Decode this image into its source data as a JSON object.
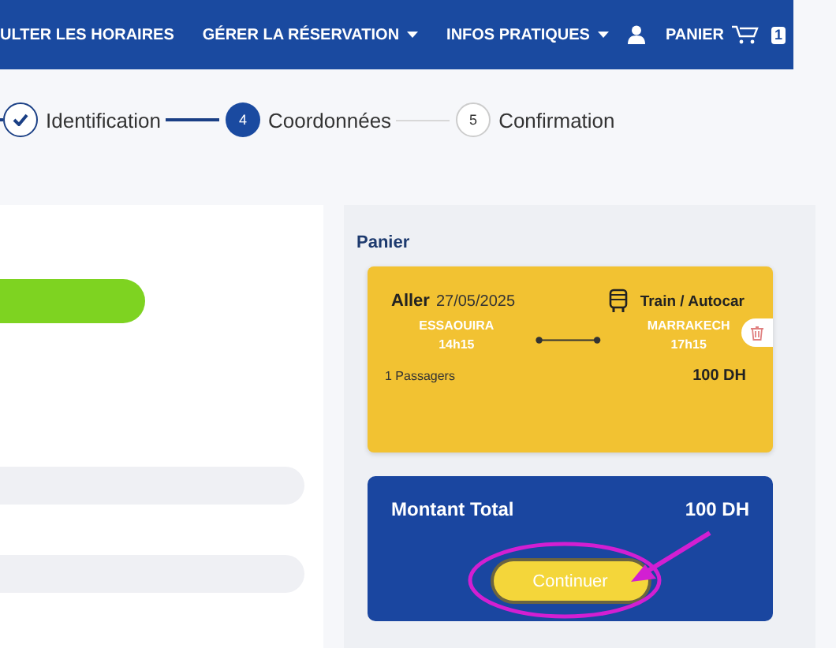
{
  "nav": {
    "items": [
      {
        "label": "ULTER LES HORAIRES",
        "dropdown": false
      },
      {
        "label": "GÉRER LA RÉSERVATION",
        "dropdown": true
      },
      {
        "label": "INFOS PRATIQUES",
        "dropdown": true
      }
    ],
    "cart": {
      "label": "PANIER",
      "count": "1"
    }
  },
  "steps": [
    {
      "kind": "done",
      "label": "Identification"
    },
    {
      "kind": "current",
      "number": "4",
      "label": "Coordonnées"
    },
    {
      "kind": "pending",
      "number": "5",
      "label": "Confirmation"
    }
  ],
  "cart_panel": {
    "title": "Panier",
    "trip": {
      "direction": "Aller",
      "date": "27/05/2025",
      "mode": "Train / Autocar",
      "from": {
        "city": "ESSAOUIRA",
        "time": "14h15"
      },
      "to": {
        "city": "MARRAKECH",
        "time": "17h15"
      },
      "passengers": "1 Passagers",
      "price": "100 DH"
    },
    "total": {
      "label": "Montant Total",
      "value": "100 DH",
      "button": "Continuer"
    },
    "annotation": {
      "kind": "circle-arrow"
    }
  }
}
